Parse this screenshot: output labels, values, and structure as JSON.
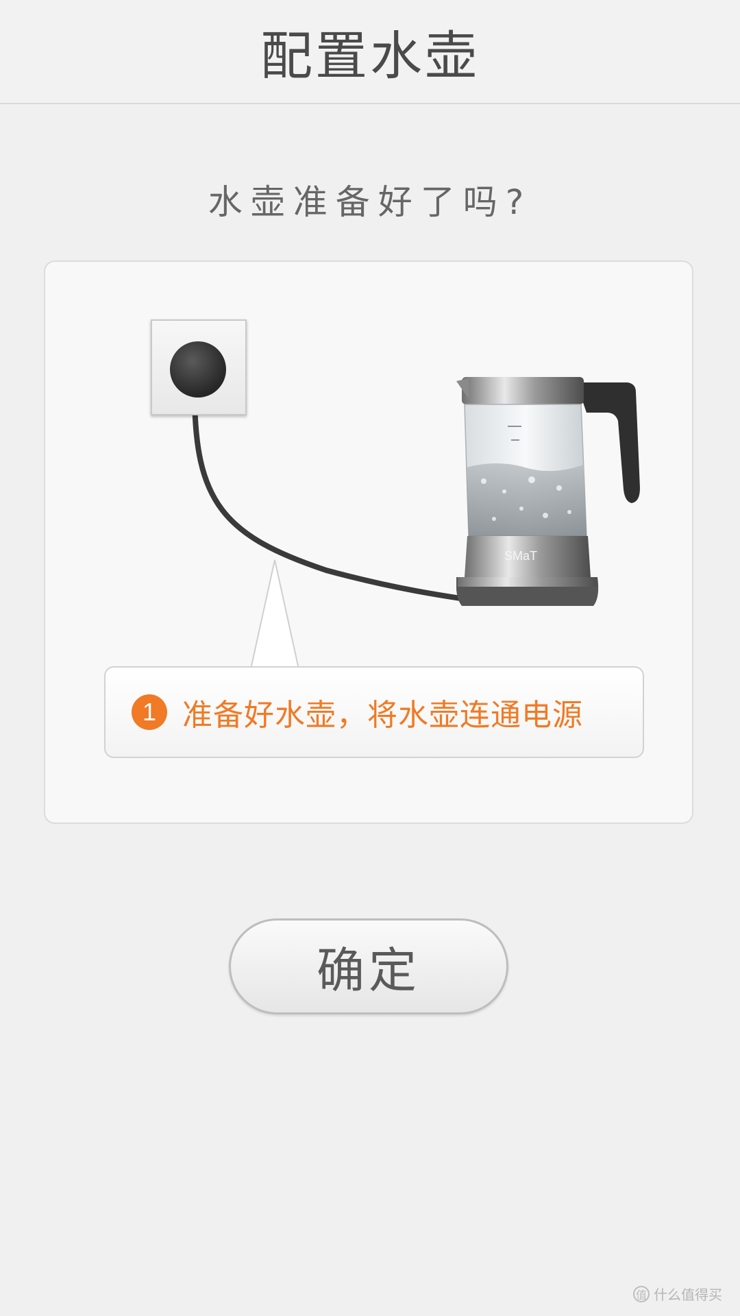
{
  "header": {
    "title": "配置水壶"
  },
  "question": "水壶准备好了吗?",
  "illustration": {
    "kettle_brand": "SMaT",
    "socket_icon": "power-socket-icon",
    "kettle_icon": "electric-kettle-icon"
  },
  "step": {
    "number": "1",
    "text": "准备好水壶，将水壶连通电源"
  },
  "confirm_button": {
    "label": "确定"
  },
  "watermark": {
    "text": "什么值得买"
  },
  "colors": {
    "accent": "#f07a25",
    "background": "#f0f0f0"
  }
}
